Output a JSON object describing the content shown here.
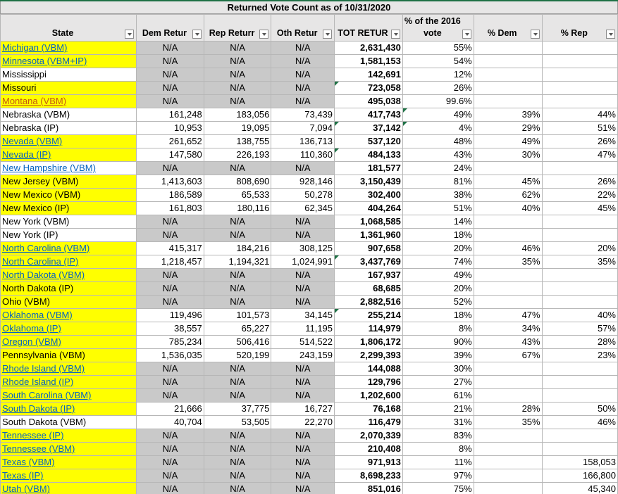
{
  "title": "Returned Vote Count as of 10/31/2020",
  "headers": {
    "state": "State",
    "dem": "Dem Retur",
    "rep": "Rep Returr",
    "oth": "Oth Retur",
    "tot": "TOT RETUR",
    "pct2016_line1": "% of the 2016",
    "pct2016_line2": "vote",
    "pdem": "% Dem",
    "prep": "% Rep"
  },
  "colors": {
    "highlight": "#ffff00",
    "na_fill": "#c9c9c9",
    "header_fill": "#e7e6e6",
    "link": "#0563c1",
    "link_orange": "#c65911"
  },
  "rows": [
    {
      "state": "Michigan (VBM)",
      "dem": "N/A",
      "rep": "N/A",
      "oth": "N/A",
      "tot": "2,631,430",
      "pct": "55%",
      "pdem": "",
      "prep": ""
    },
    {
      "state": "Minnesota (VBM+IP)",
      "dem": "N/A",
      "rep": "N/A",
      "oth": "N/A",
      "tot": "1,581,153",
      "pct": "54%",
      "pdem": "",
      "prep": ""
    },
    {
      "state": "Mississippi",
      "dem": "N/A",
      "rep": "N/A",
      "oth": "N/A",
      "tot": "142,691",
      "pct": "12%",
      "pdem": "",
      "prep": ""
    },
    {
      "state": "Missouri",
      "dem": "N/A",
      "rep": "N/A",
      "oth": "N/A",
      "tot": "723,058",
      "pct": "26%",
      "pdem": "",
      "prep": ""
    },
    {
      "state": "Montana (VBM)",
      "dem": "N/A",
      "rep": "N/A",
      "oth": "N/A",
      "tot": "495,038",
      "pct": "99.6%",
      "pdem": "",
      "prep": ""
    },
    {
      "state": "Nebraska (VBM)",
      "dem": "161,248",
      "rep": "183,056",
      "oth": "73,439",
      "tot": "417,743",
      "pct": "49%",
      "pdem": "39%",
      "prep": "44%"
    },
    {
      "state": "Nebraska (IP)",
      "dem": "10,953",
      "rep": "19,095",
      "oth": "7,094",
      "tot": "37,142",
      "pct": "4%",
      "pdem": "29%",
      "prep": "51%"
    },
    {
      "state": "Nevada (VBM)",
      "dem": "261,652",
      "rep": "138,755",
      "oth": "136,713",
      "tot": "537,120",
      "pct": "48%",
      "pdem": "49%",
      "prep": "26%"
    },
    {
      "state": "Nevada (IP)",
      "dem": "147,580",
      "rep": "226,193",
      "oth": "110,360",
      "tot": "484,133",
      "pct": "43%",
      "pdem": "30%",
      "prep": "47%"
    },
    {
      "state": "New Hampshire (VBM)",
      "dem": "N/A",
      "rep": "N/A",
      "oth": "N/A",
      "tot": "181,577",
      "pct": "24%",
      "pdem": "",
      "prep": ""
    },
    {
      "state": "New Jersey (VBM)",
      "dem": "1,413,603",
      "rep": "808,690",
      "oth": "928,146",
      "tot": "3,150,439",
      "pct": "81%",
      "pdem": "45%",
      "prep": "26%"
    },
    {
      "state": "New Mexico (VBM)",
      "dem": "186,589",
      "rep": "65,533",
      "oth": "50,278",
      "tot": "302,400",
      "pct": "38%",
      "pdem": "62%",
      "prep": "22%"
    },
    {
      "state": "New Mexico (IP)",
      "dem": "161,803",
      "rep": "180,116",
      "oth": "62,345",
      "tot": "404,264",
      "pct": "51%",
      "pdem": "40%",
      "prep": "45%"
    },
    {
      "state": "New York (VBM)",
      "dem": "N/A",
      "rep": "N/A",
      "oth": "N/A",
      "tot": "1,068,585",
      "pct": "14%",
      "pdem": "",
      "prep": ""
    },
    {
      "state": "New York (IP)",
      "dem": "N/A",
      "rep": "N/A",
      "oth": "N/A",
      "tot": "1,361,960",
      "pct": "18%",
      "pdem": "",
      "prep": ""
    },
    {
      "state": "North Carolina (VBM)",
      "dem": "415,317",
      "rep": "184,216",
      "oth": "308,125",
      "tot": "907,658",
      "pct": "20%",
      "pdem": "46%",
      "prep": "20%"
    },
    {
      "state": "North Carolina (IP)",
      "dem": "1,218,457",
      "rep": "1,194,321",
      "oth": "1,024,991",
      "tot": "3,437,769",
      "pct": "74%",
      "pdem": "35%",
      "prep": "35%"
    },
    {
      "state": "North Dakota (VBM)",
      "dem": "N/A",
      "rep": "N/A",
      "oth": "N/A",
      "tot": "167,937",
      "pct": "49%",
      "pdem": "",
      "prep": ""
    },
    {
      "state": "North Dakota (IP)",
      "dem": "N/A",
      "rep": "N/A",
      "oth": "N/A",
      "tot": "68,685",
      "pct": "20%",
      "pdem": "",
      "prep": ""
    },
    {
      "state": "Ohio (VBM)",
      "dem": "N/A",
      "rep": "N/A",
      "oth": "N/A",
      "tot": "2,882,516",
      "pct": "52%",
      "pdem": "",
      "prep": ""
    },
    {
      "state": "Oklahoma (VBM)",
      "dem": "119,496",
      "rep": "101,573",
      "oth": "34,145",
      "tot": "255,214",
      "pct": "18%",
      "pdem": "47%",
      "prep": "40%"
    },
    {
      "state": "Oklahoma (IP)",
      "dem": "38,557",
      "rep": "65,227",
      "oth": "11,195",
      "tot": "114,979",
      "pct": "8%",
      "pdem": "34%",
      "prep": "57%"
    },
    {
      "state": "Oregon (VBM)",
      "dem": "785,234",
      "rep": "506,416",
      "oth": "514,522",
      "tot": "1,806,172",
      "pct": "90%",
      "pdem": "43%",
      "prep": "28%"
    },
    {
      "state": "Pennsylvania (VBM)",
      "dem": "1,536,035",
      "rep": "520,199",
      "oth": "243,159",
      "tot": "2,299,393",
      "pct": "39%",
      "pdem": "67%",
      "prep": "23%"
    },
    {
      "state": "Rhode Island (VBM)",
      "dem": "N/A",
      "rep": "N/A",
      "oth": "N/A",
      "tot": "144,088",
      "pct": "30%",
      "pdem": "",
      "prep": ""
    },
    {
      "state": "Rhode Island (IP)",
      "dem": "N/A",
      "rep": "N/A",
      "oth": "N/A",
      "tot": "129,796",
      "pct": "27%",
      "pdem": "",
      "prep": ""
    },
    {
      "state": "South Carolina (VBM)",
      "dem": "N/A",
      "rep": "N/A",
      "oth": "N/A",
      "tot": "1,202,600",
      "pct": "61%",
      "pdem": "",
      "prep": ""
    },
    {
      "state": "South Dakota (IP)",
      "dem": "21,666",
      "rep": "37,775",
      "oth": "16,727",
      "tot": "76,168",
      "pct": "21%",
      "pdem": "28%",
      "prep": "50%"
    },
    {
      "state": "South Dakota (VBM)",
      "dem": "40,704",
      "rep": "53,505",
      "oth": "22,270",
      "tot": "116,479",
      "pct": "31%",
      "pdem": "35%",
      "prep": "46%"
    },
    {
      "state": "Tennessee (IP)",
      "dem": "N/A",
      "rep": "N/A",
      "oth": "N/A",
      "tot": "2,070,339",
      "pct": "83%",
      "pdem": "",
      "prep": ""
    },
    {
      "state": "Tennessee (VBM)",
      "dem": "N/A",
      "rep": "N/A",
      "oth": "N/A",
      "tot": "210,408",
      "pct": "8%",
      "pdem": "",
      "prep": ""
    },
    {
      "state": "Texas (VBM)",
      "dem": "N/A",
      "rep": "N/A",
      "oth": "N/A",
      "tot": "971,913",
      "pct": "11%",
      "pdem": "",
      "prep": "158,053"
    },
    {
      "state": "Texas (IP)",
      "dem": "N/A",
      "rep": "N/A",
      "oth": "N/A",
      "tot": "8,698,233",
      "pct": "97%",
      "pdem": "",
      "prep": "166,800"
    },
    {
      "state": "Utah (VBM)",
      "dem": "N/A",
      "rep": "N/A",
      "oth": "N/A",
      "tot": "851,016",
      "pct": "75%",
      "pdem": "",
      "prep": "45,340"
    }
  ]
}
